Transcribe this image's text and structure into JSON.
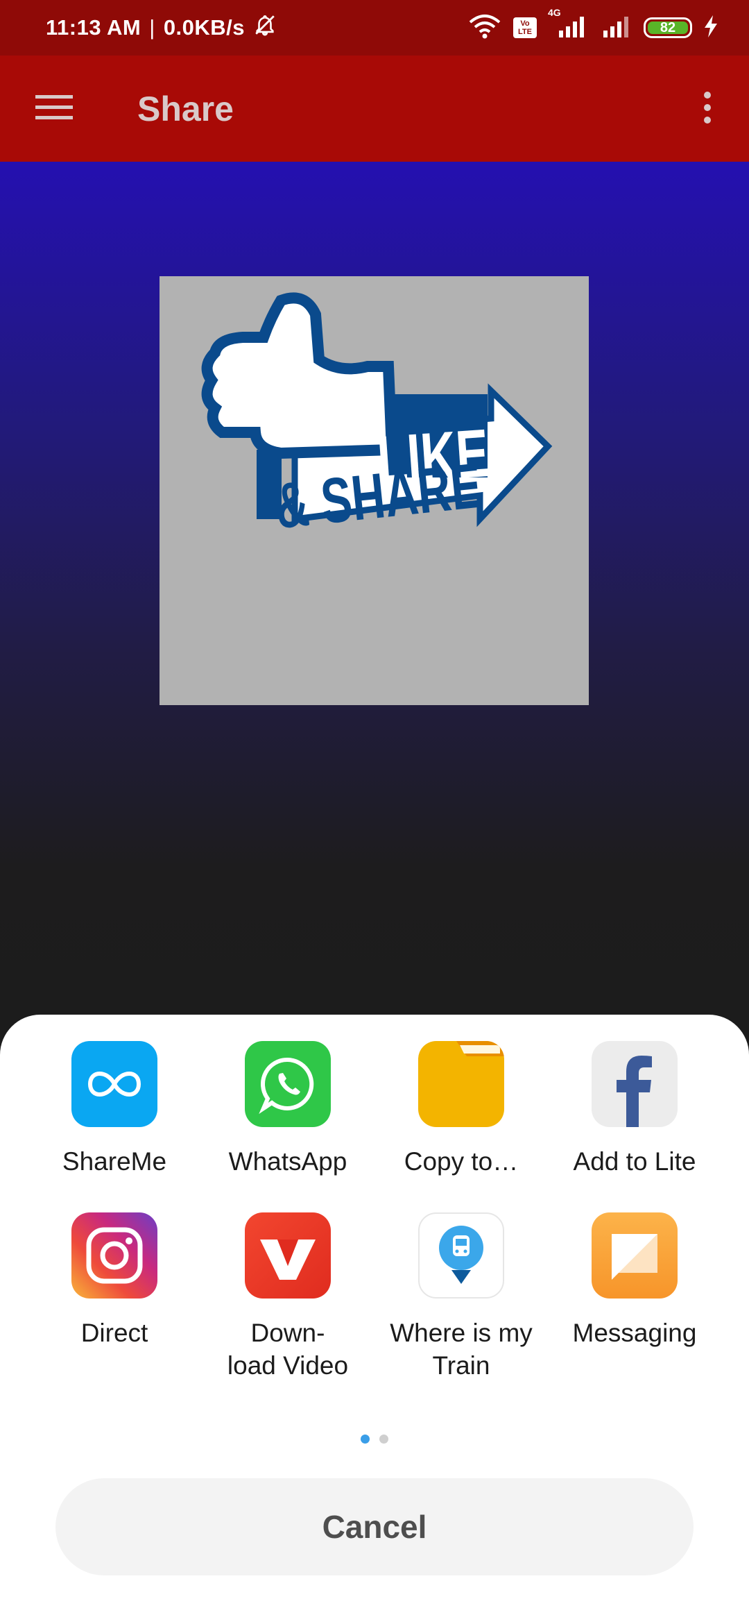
{
  "status_bar": {
    "time": "11:13 AM",
    "separator": "|",
    "net_speed": "0.0KB/s",
    "volte_line1": "Vo",
    "volte_line2": "LTE",
    "network_type": "4G",
    "battery_level": "82",
    "icons": [
      "muted-bell-icon",
      "wifi-icon",
      "volte-icon",
      "signal-icon",
      "signal-icon",
      "battery-icon",
      "charging-icon"
    ]
  },
  "app_bar": {
    "title": "Share",
    "menu_icon": "hamburger-menu-icon",
    "more_icon": "more-vert-icon"
  },
  "image": {
    "line1": "LIKE",
    "line2": "& SHARE"
  },
  "share_sheet": {
    "apps": [
      {
        "label": "ShareMe",
        "icon": "shareme-icon"
      },
      {
        "label": "WhatsApp",
        "icon": "whatsapp-icon"
      },
      {
        "label": "Copy to…",
        "icon": "folder-icon"
      },
      {
        "label": "Add to Lite",
        "icon": "facebook-icon"
      },
      {
        "label": "Direct",
        "icon": "instagram-icon"
      },
      {
        "label": "Down-\nload Video",
        "icon": "vidmate-icon"
      },
      {
        "label": "Where is my\nTrain",
        "icon": "train-icon"
      },
      {
        "label": "Messaging",
        "icon": "messaging-icon"
      }
    ],
    "page_count": 2,
    "current_page": 1,
    "cancel_label": "Cancel"
  },
  "colors": {
    "status_bar": "#8f0a07",
    "app_bar": "#a80a06",
    "accent_dot": "#3a9ee8",
    "like_blue": "#0a4a8c"
  }
}
